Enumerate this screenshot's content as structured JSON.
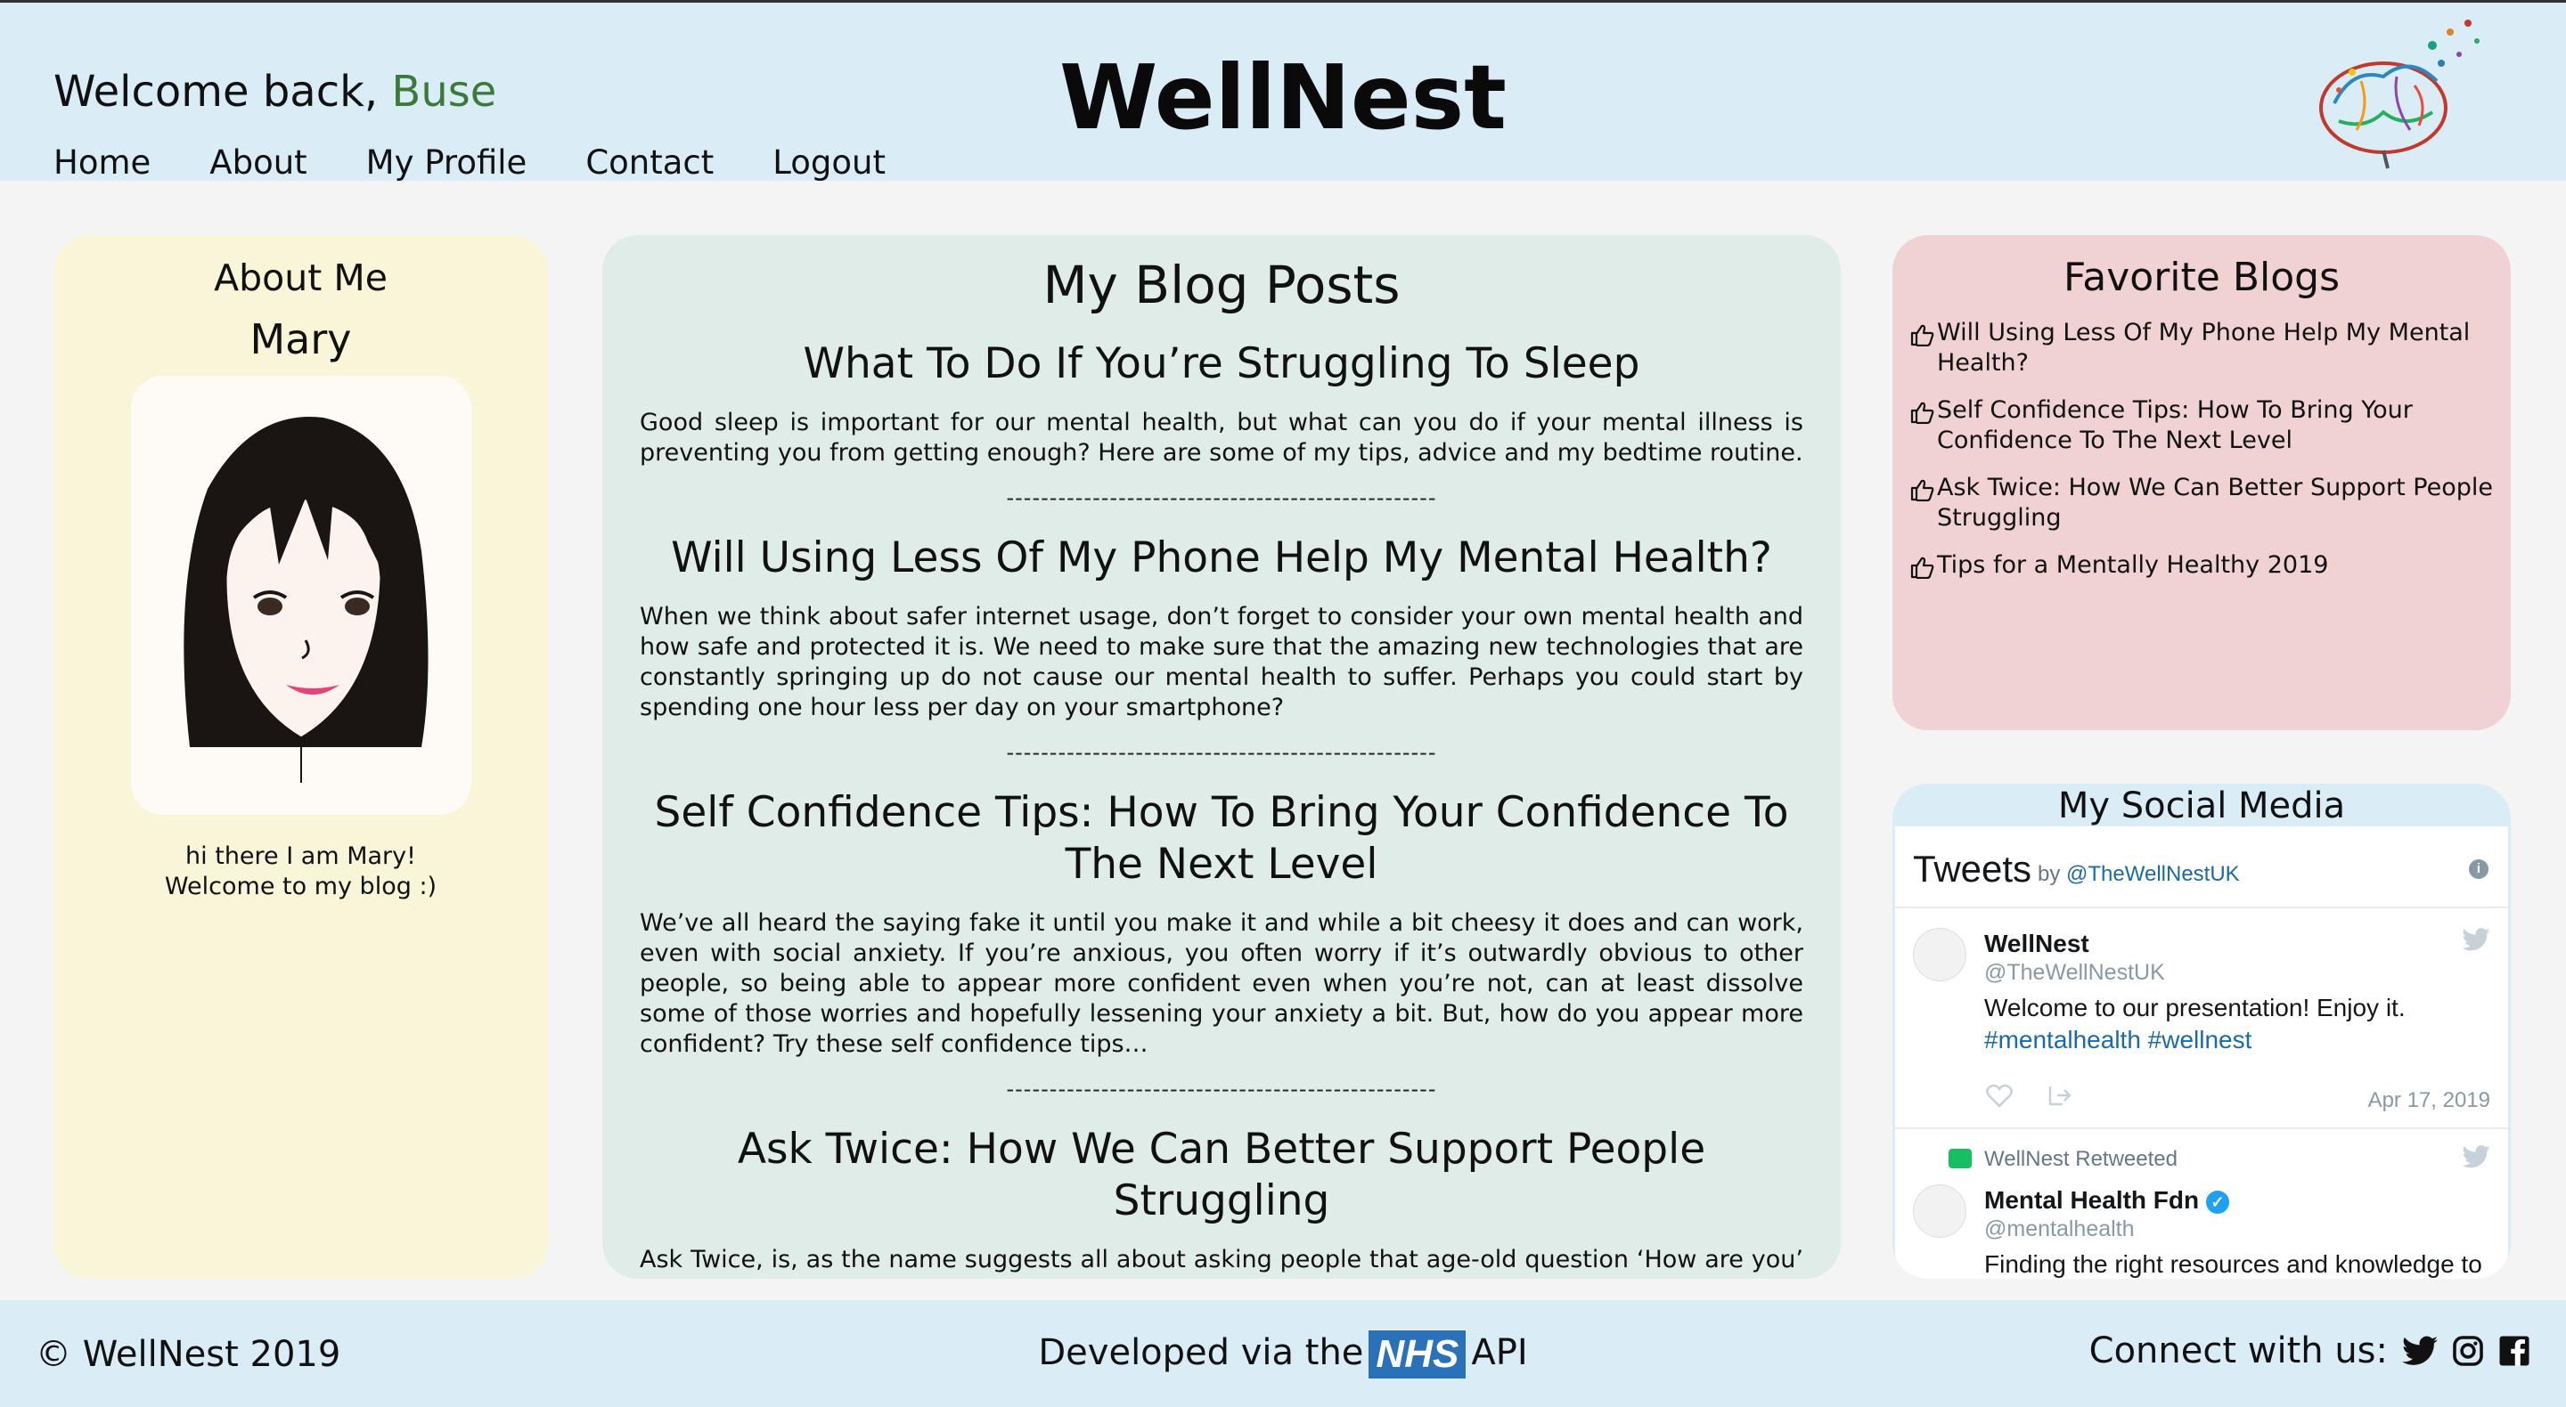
{
  "header": {
    "welcome_prefix": "Welcome back, ",
    "username": "Buse",
    "brand": "WellNest",
    "nav": [
      "Home",
      "About",
      "My Profile",
      "Contact",
      "Logout"
    ]
  },
  "about": {
    "title": "About Me",
    "name": "Mary",
    "bio": "hi there I am Mary! Welcome to my blog :)"
  },
  "blog": {
    "title": "My Blog Posts",
    "separator": "--------------------------------------------------",
    "posts": [
      {
        "title": "What To Do If You’re Struggling To Sleep",
        "excerpt": "Good sleep is important for our mental health, but what can you do if your mental illness is preventing you from getting enough? Here are some of my tips, advice and my bedtime routine."
      },
      {
        "title": "Will Using Less Of My Phone Help My Mental Health?",
        "excerpt": "When we think about safer internet usage, don’t forget to consider your own mental health and how safe and protected it is. We need to make sure that the amazing new technologies that are constantly springing up do not cause our mental health to suffer. Perhaps you could start by spending one hour less per day on your smartphone?"
      },
      {
        "title": "Self Confidence Tips: How To Bring Your Confidence To The Next Level",
        "excerpt": "We’ve all heard the saying fake it until you make it and while a bit cheesy it does and can work, even with social anxiety. If you’re anxious, you often worry if it’s outwardly obvious to other people, so being able to appear more confident even when you’re not, can at least dissolve some of those worries and hopefully lessening your anxiety a bit. But, how do you appear more confident? Try these self confidence tips…"
      },
      {
        "title": "Ask Twice: How We Can Better Support People Struggling",
        "excerpt": "Ask Twice, is, as the name suggests all about asking people that age-old question ‘How are you’ more than once. The reason for this is that, more often than not, people asked this will just say ‘I’m Fine’ and the reasons for it … and the result. The reason for this is because they are used to the question."
      }
    ]
  },
  "favorites": {
    "title": "Favorite Blogs",
    "items": [
      "Will Using Less Of My Phone Help My Mental Health?",
      "Self Confidence Tips: How To Bring Your Confidence To The Next Level",
      "Ask Twice: How We Can Better Support People Struggling",
      "Tips for a Mentally Healthy 2019"
    ]
  },
  "social": {
    "title": "My Social Media",
    "tweets_label": "Tweets",
    "by_label": "by",
    "by_handle": "@TheWellNestUK",
    "tweet1": {
      "name": "WellNest",
      "handle": "@TheWellNestUK",
      "text": "Welcome to our presentation! Enjoy it.",
      "hashtags": "#mentalhealth #wellnest",
      "date": "Apr 17, 2019"
    },
    "tweet2": {
      "retweet_label": "WellNest Retweeted",
      "name": "Mental Health Fdn",
      "handle": "@mentalhealth",
      "text": "Finding the right resources and knowledge to"
    }
  },
  "footer": {
    "copyright": "© WellNest 2019",
    "dev_prefix": "Developed via the",
    "nhs": "NHS",
    "dev_suffix": "API",
    "connect": "Connect with us:"
  },
  "colors": {
    "header_bg": "#daedf7",
    "username": "#3b7a3b",
    "about_bg": "#f8f5d9",
    "blog_bg": "#e0ece8",
    "favs_bg": "#f0d2d2",
    "nhs_blue": "#2a71b8"
  }
}
